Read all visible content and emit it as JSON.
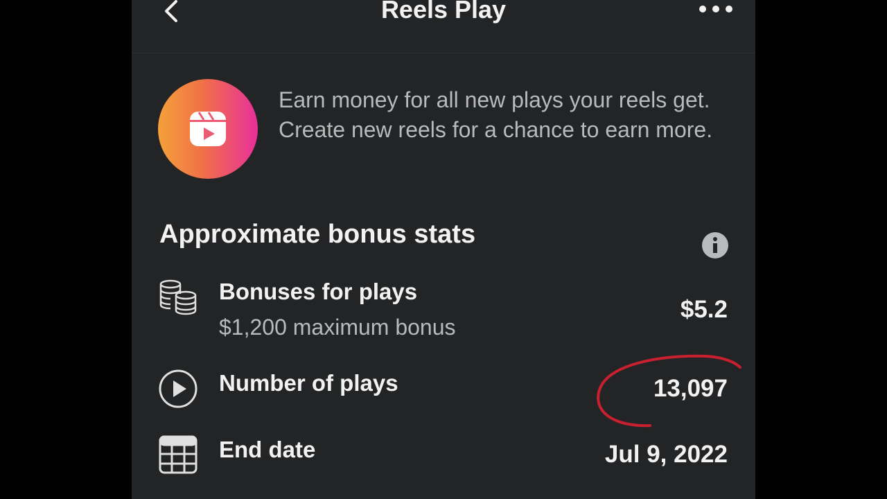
{
  "header": {
    "title": "Reels Play",
    "back_icon": "chevron-left-icon",
    "more_icon": "more-horizontal-icon"
  },
  "intro": {
    "icon": "reels-icon",
    "text": "Earn money for all new plays your reels get. Create new reels for a chance to earn more."
  },
  "stats": {
    "title": "Approximate bonus stats",
    "info_icon": "info-icon",
    "rows": [
      {
        "icon": "coins-icon",
        "label": "Bonuses for plays",
        "sublabel": "$1,200 maximum bonus",
        "value": "$5.2"
      },
      {
        "icon": "play-circle-icon",
        "label": "Number of plays",
        "value": "13,097"
      },
      {
        "icon": "calendar-icon",
        "label": "End date",
        "value": "Jul 9, 2022"
      }
    ]
  },
  "colors": {
    "background": "#232425",
    "text": "#f2f2f2",
    "muted": "#b9babb",
    "annotation": "#c8202e"
  }
}
